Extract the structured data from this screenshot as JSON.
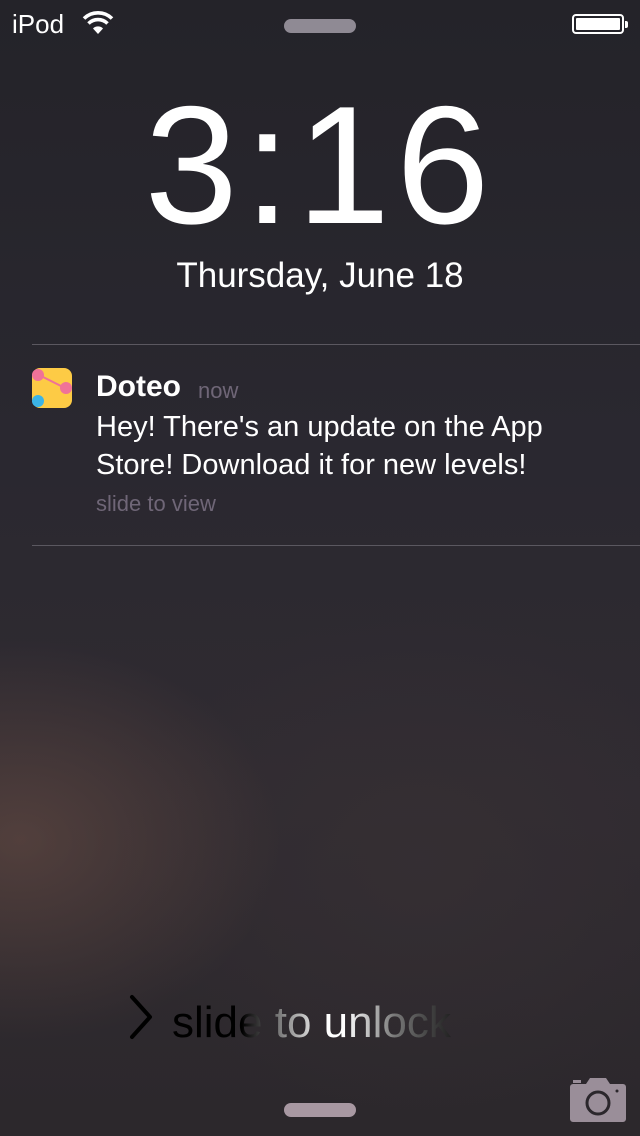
{
  "status_bar": {
    "carrier": "iPod",
    "wifi_icon": "wifi-icon",
    "battery_level": 1.0
  },
  "lock_screen": {
    "time": "3:16",
    "date": "Thursday, June 18"
  },
  "notification": {
    "app_name": "Doteo",
    "time": "now",
    "message": "Hey! There's an update on the App Store! Download it for new levels!",
    "action_hint": "slide to view",
    "icon_colors": {
      "background": "#fdcb45",
      "dot_pink": "#f07298",
      "dot_blue": "#3bb4e6"
    }
  },
  "bottom": {
    "slide_label": "slide to unlock",
    "camera_icon": "camera-icon"
  }
}
